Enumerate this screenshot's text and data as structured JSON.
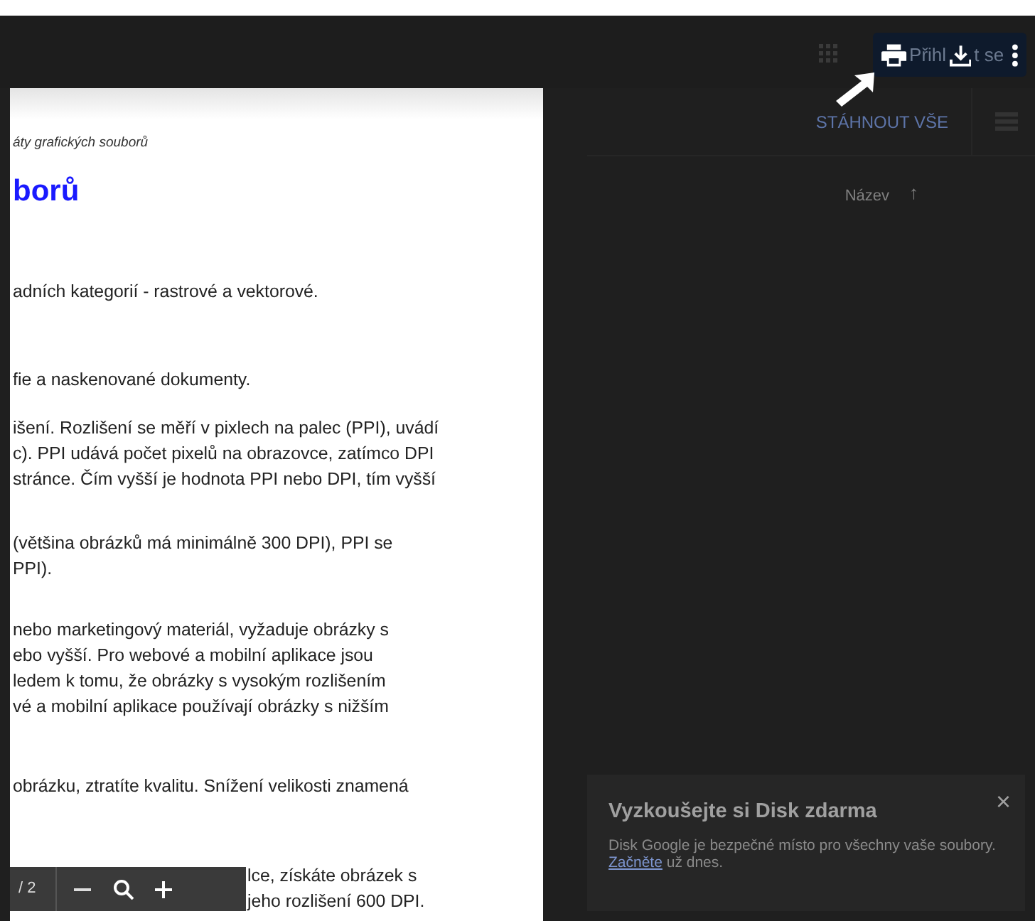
{
  "header": {
    "sign_in_parts": [
      "Přihl",
      "t se"
    ]
  },
  "file_panel": {
    "download_all": "STÁHNOUT VŠE",
    "sort_column": "Název",
    "sort_arrow": "↑"
  },
  "document": {
    "paragraphs": [
      {
        "kind": "subtitle",
        "lines": [
          "áty grafických souborů"
        ]
      },
      {
        "kind": "heading",
        "lines": [
          "borů"
        ]
      },
      {
        "kind": "body",
        "lines": [
          "adních kategorií - rastrové a vektorové."
        ]
      },
      {
        "kind": "body",
        "lines": [
          "fie a naskenované dokumenty."
        ]
      },
      {
        "kind": "body",
        "lines": [
          "išení. Rozlišení se měří v pixlech na palec (PPI), uvádí",
          "c). PPI udává počet pixelů na obrazovce, zatímco DPI",
          "stránce. Čím vyšší je hodnota PPI nebo DPI, tím vyšší"
        ]
      },
      {
        "kind": "body",
        "lines": [
          "(většina obrázků má minimálně 300 DPI), PPI se",
          "PPI)."
        ]
      },
      {
        "kind": "body",
        "lines": [
          "nebo marketingový materiál, vyžaduje obrázky s",
          "ebo vyšší. Pro webové a mobilní aplikace jsou",
          "ledem k tomu, že obrázky s vysokým rozlišením",
          "vé a mobilní aplikace používají obrázky s nižším"
        ]
      },
      {
        "kind": "body",
        "lines": [
          "obrázku, ztratíte kvalitu. Snížení velikosti znamená"
        ]
      },
      {
        "kind": "covered",
        "lines": [
          "lce, získáte obrázek s",
          "jeho rozlišení 600 DPI."
        ]
      }
    ]
  },
  "viewer_toolbar": {
    "page": "/ 2"
  },
  "promo": {
    "title": "Vyzkoušejte si Disk zdarma",
    "body": "Disk Google je bezpečné místo pro všechny vaše soubory.",
    "link": "Začněte",
    "link_suffix": " už dnes.",
    "close": "×"
  }
}
